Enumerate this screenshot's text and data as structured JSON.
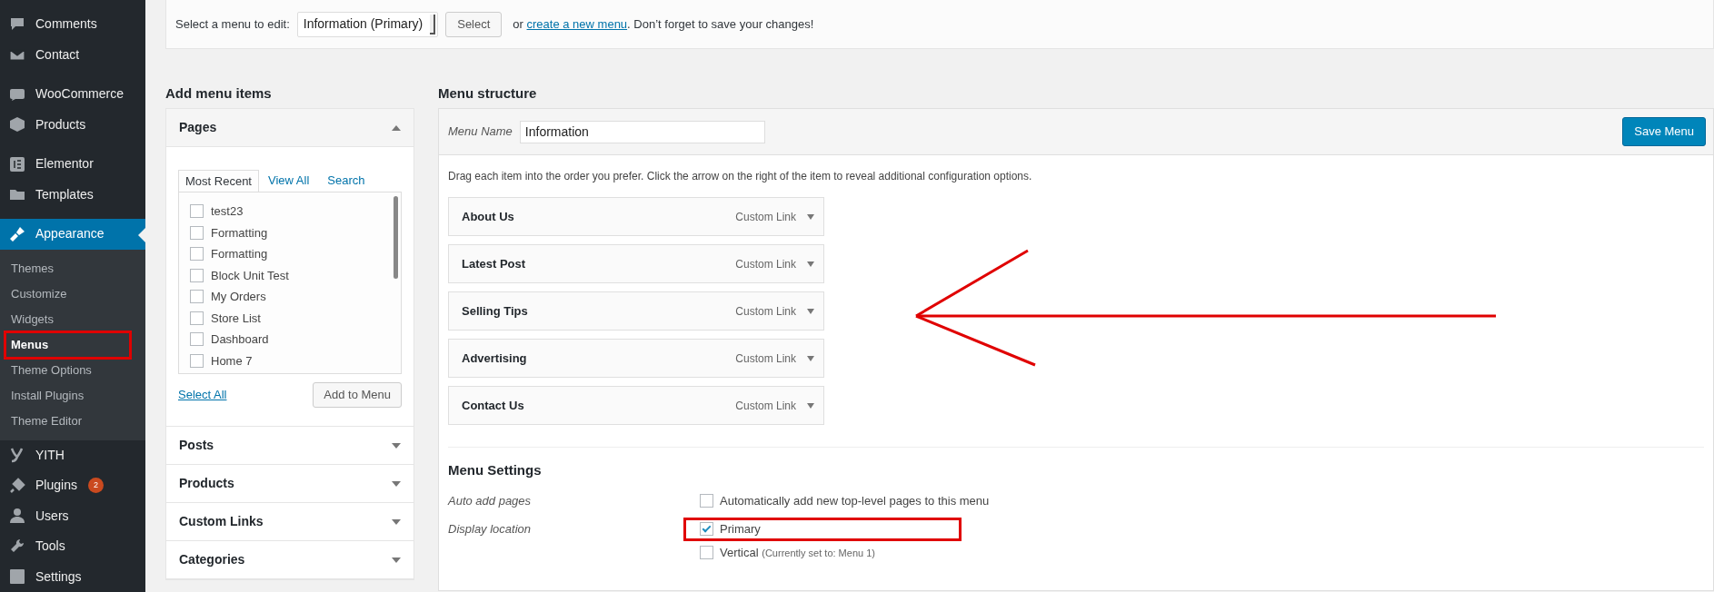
{
  "sidebar": {
    "items": [
      {
        "label": "Comments",
        "selected": false
      },
      {
        "label": "Contact",
        "selected": false
      },
      {
        "label": "WooCommerce",
        "selected": false
      },
      {
        "label": "Products",
        "selected": false
      },
      {
        "label": "Elementor",
        "selected": false
      },
      {
        "label": "Templates",
        "selected": false
      },
      {
        "label": "Appearance",
        "selected": true,
        "children": [
          {
            "label": "Themes",
            "selected": false,
            "highlighted": false
          },
          {
            "label": "Customize",
            "selected": false,
            "highlighted": false
          },
          {
            "label": "Widgets",
            "selected": false,
            "highlighted": false
          },
          {
            "label": "Menus",
            "selected": true,
            "highlighted": true
          },
          {
            "label": "Theme Options",
            "selected": false,
            "highlighted": false
          },
          {
            "label": "Install Plugins",
            "selected": false,
            "highlighted": false
          },
          {
            "label": "Theme Editor",
            "selected": false,
            "highlighted": false
          }
        ]
      },
      {
        "label": "YITH",
        "selected": false
      },
      {
        "label": "Plugins",
        "selected": false,
        "badge": "2"
      },
      {
        "label": "Users",
        "selected": false
      },
      {
        "label": "Tools",
        "selected": false
      },
      {
        "label": "Settings",
        "selected": false
      }
    ]
  },
  "menu_select": {
    "label": "Select a menu to edit:",
    "value": "Information (Primary)",
    "button": "Select",
    "text_before": "or",
    "link": "create a new menu",
    "text_after": ". Don’t forget to save your changes!"
  },
  "add_menu_items": {
    "title": "Add menu items",
    "sections": [
      {
        "title": "Pages",
        "expanded": true,
        "tabs": [
          {
            "label": "Most Recent",
            "selected": true
          },
          {
            "label": "View All",
            "selected": false
          },
          {
            "label": "Search",
            "selected": false
          }
        ],
        "items": [
          {
            "label": "test23",
            "checked": false
          },
          {
            "label": "Formatting",
            "checked": false
          },
          {
            "label": "Formatting",
            "checked": false
          },
          {
            "label": "Block Unit Test",
            "checked": false
          },
          {
            "label": "My Orders",
            "checked": false
          },
          {
            "label": "Store List",
            "checked": false
          },
          {
            "label": "Dashboard",
            "checked": false
          },
          {
            "label": "Home 7",
            "checked": false
          }
        ],
        "select_all": "Select All",
        "add_button": "Add to Menu"
      },
      {
        "title": "Posts",
        "expanded": false
      },
      {
        "title": "Products",
        "expanded": false
      },
      {
        "title": "Custom Links",
        "expanded": false
      },
      {
        "title": "Categories",
        "expanded": false
      }
    ]
  },
  "menu_structure": {
    "title": "Menu structure",
    "name_label": "Menu Name",
    "name_value": "Information",
    "save_button": "Save Menu",
    "instructions": "Drag each item into the order you prefer. Click the arrow on the right of the item to reveal additional configuration options.",
    "items": [
      {
        "title": "About Us",
        "type": "Custom Link"
      },
      {
        "title": "Latest Post",
        "type": "Custom Link"
      },
      {
        "title": "Selling Tips",
        "type": "Custom Link"
      },
      {
        "title": "Advertising",
        "type": "Custom Link"
      },
      {
        "title": "Contact Us",
        "type": "Custom Link"
      }
    ],
    "annotations": [
      {
        "kind": "arrow"
      }
    ]
  },
  "menu_settings": {
    "title": "Menu Settings",
    "auto_add": {
      "label": "Auto add pages",
      "option": "Automatically add new top-level pages to this menu",
      "checked": false
    },
    "display_location": {
      "label": "Display location",
      "options": [
        {
          "label": "Primary",
          "checked": true,
          "highlighted": true
        },
        {
          "label": "Vertical",
          "note": "(Currently set to: Menu 1)",
          "checked": false,
          "highlighted": false
        }
      ]
    }
  }
}
